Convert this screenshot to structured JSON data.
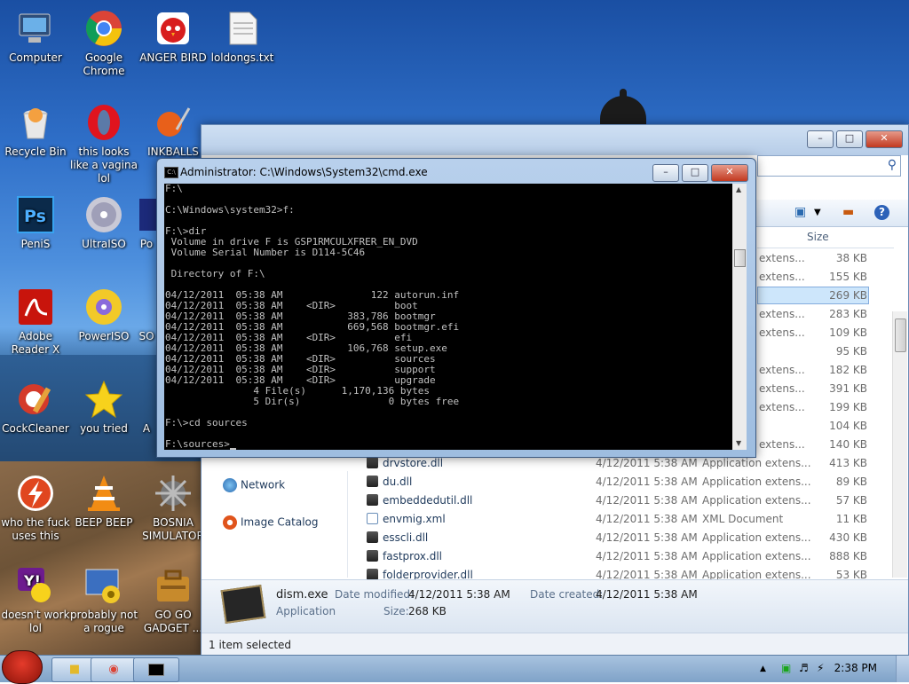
{
  "desktop": {
    "icons": [
      {
        "label": "Computer",
        "icon": "computer-icon"
      },
      {
        "label": "Google Chrome",
        "icon": "chrome-icon"
      },
      {
        "label": "ANGER BIRD",
        "icon": "angry-bird-icon"
      },
      {
        "label": "loldongs.txt",
        "icon": "text-file-icon"
      },
      {
        "label": "Recycle Bin",
        "icon": "recycle-bin-icon"
      },
      {
        "label": "this looks like a vagina lol",
        "icon": "opera-icon"
      },
      {
        "label": "INKBALLS",
        "icon": "inkball-icon"
      },
      {
        "label": "PeniS",
        "icon": "photoshop-icon"
      },
      {
        "label": "UltraISO",
        "icon": "ultraiso-icon"
      },
      {
        "label": "Po",
        "icon": "app-icon"
      },
      {
        "label": "Adobe Reader X",
        "icon": "adobe-reader-icon"
      },
      {
        "label": "PowerISO",
        "icon": "poweriso-icon"
      },
      {
        "label": "SO",
        "icon": "app-icon"
      },
      {
        "label": "CockCleaner",
        "icon": "ccleaner-icon"
      },
      {
        "label": "you tried",
        "icon": "star-icon"
      },
      {
        "label": "A",
        "icon": "app-icon"
      },
      {
        "label": "who the fuck uses this",
        "icon": "flash-icon"
      },
      {
        "label": "BEEP BEEP",
        "icon": "vlc-icon"
      },
      {
        "label": "BOSNIA SIMULATOR",
        "icon": "bosnia-icon"
      },
      {
        "label": "doesn't work lol",
        "icon": "yahoo-icon"
      },
      {
        "label": "probably not a rogue",
        "icon": "settings-icon"
      },
      {
        "label": "GO GO GADGET ...",
        "icon": "gadget-icon"
      }
    ]
  },
  "cmd": {
    "title": "Administrator: C:\\Windows\\System32\\cmd.exe",
    "icon_text": "C:\\",
    "lines": [
      "F:\\",
      "",
      "C:\\Windows\\system32>f:",
      "",
      "F:\\>dir",
      " Volume in drive F is GSP1RMCULXFRER_EN_DVD",
      " Volume Serial Number is D114-5C46",
      "",
      " Directory of F:\\",
      "",
      "04/12/2011  05:38 AM               122 autorun.inf",
      "04/12/2011  05:38 AM    <DIR>          boot",
      "04/12/2011  05:38 AM           383,786 bootmgr",
      "04/12/2011  05:38 AM           669,568 bootmgr.efi",
      "04/12/2011  05:38 AM    <DIR>          efi",
      "04/12/2011  05:38 AM           106,768 setup.exe",
      "04/12/2011  05:38 AM    <DIR>          sources",
      "04/12/2011  05:38 AM    <DIR>          support",
      "04/12/2011  05:38 AM    <DIR>          upgrade",
      "               4 File(s)      1,170,136 bytes",
      "               5 Dir(s)               0 bytes free",
      "",
      "F:\\>cd sources",
      ""
    ],
    "prompt": "F:\\sources>"
  },
  "explorer": {
    "size_header": "Size",
    "partial_rows": [
      {
        "type": "extens...",
        "size": "38 KB"
      },
      {
        "type": "extens...",
        "size": "155 KB"
      },
      {
        "type": "",
        "size": "269 KB",
        "selected": true
      },
      {
        "type": "extens...",
        "size": "283 KB"
      },
      {
        "type": "extens...",
        "size": "109 KB"
      },
      {
        "type": "",
        "size": "95 KB"
      },
      {
        "type": "extens...",
        "size": "182 KB"
      },
      {
        "type": "extens...",
        "size": "391 KB"
      },
      {
        "type": "extens...",
        "size": "199 KB"
      },
      {
        "type": "",
        "size": "104 KB"
      },
      {
        "type": "extens...",
        "size": "140 KB"
      }
    ],
    "rows": [
      {
        "name": "drvstore.dll",
        "date": "4/12/2011 5:38 AM",
        "type": "Application extens...",
        "size": "413 KB",
        "icon": "dll"
      },
      {
        "name": "du.dll",
        "date": "4/12/2011 5:38 AM",
        "type": "Application extens...",
        "size": "89 KB",
        "icon": "dll"
      },
      {
        "name": "embeddedutil.dll",
        "date": "4/12/2011 5:38 AM",
        "type": "Application extens...",
        "size": "57 KB",
        "icon": "dll"
      },
      {
        "name": "envmig.xml",
        "date": "4/12/2011 5:38 AM",
        "type": "XML Document",
        "size": "11 KB",
        "icon": "xml"
      },
      {
        "name": "esscli.dll",
        "date": "4/12/2011 5:38 AM",
        "type": "Application extens...",
        "size": "430 KB",
        "icon": "dll"
      },
      {
        "name": "fastprox.dll",
        "date": "4/12/2011 5:38 AM",
        "type": "Application extens...",
        "size": "888 KB",
        "icon": "dll"
      },
      {
        "name": "folderprovider.dll",
        "date": "4/12/2011 5:38 AM",
        "type": "Application extens...",
        "size": "53 KB",
        "icon": "dll"
      }
    ],
    "nav": [
      {
        "label": "Network",
        "icon": "network-icon"
      },
      {
        "label": "Image Catalog",
        "icon": "image-catalog-icon"
      }
    ],
    "details": {
      "filename": "dism.exe",
      "filetype": "Application",
      "date_modified_label": "Date modified:",
      "date_modified": "4/12/2011 5:38 AM",
      "size_label": "Size:",
      "size": "268 KB",
      "date_created_label": "Date created:",
      "date_created": "4/12/2011 5:38 AM"
    },
    "status": "1 item selected"
  },
  "taskbar": {
    "time": "2:38 PM"
  }
}
